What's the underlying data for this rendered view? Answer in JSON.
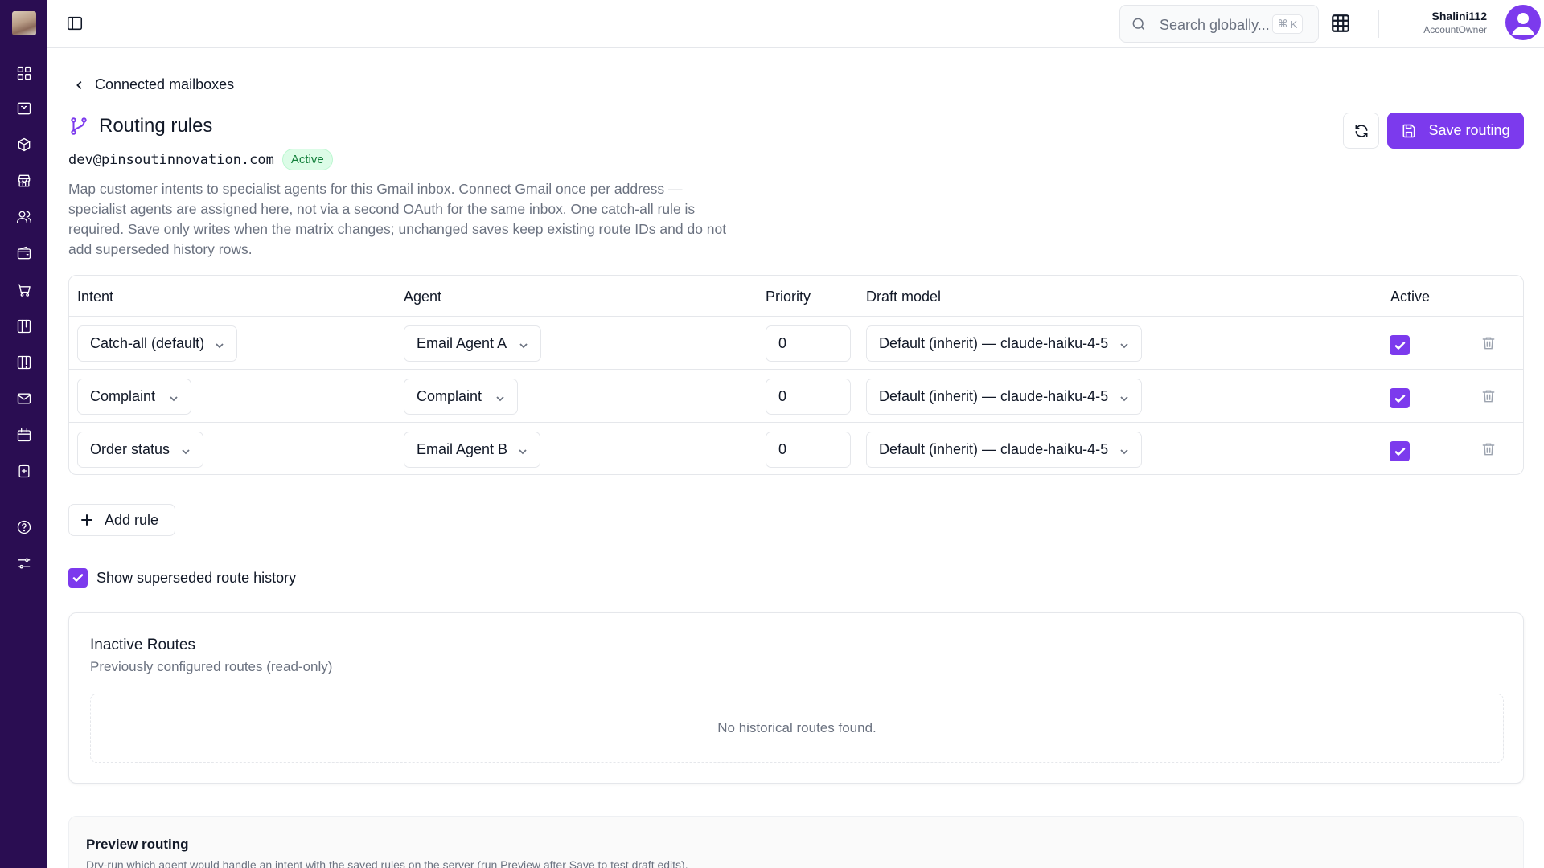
{
  "topbar": {
    "search_placeholder": "Search globally...",
    "search_shortcut_symbol": "⌘",
    "search_shortcut_key": "K",
    "user_name": "Shalini112",
    "user_role": "AccountOwner"
  },
  "sidebar": {
    "items": [
      {
        "icon": "dashboard-grid-icon"
      },
      {
        "icon": "inbox-icon"
      },
      {
        "icon": "package-icon"
      },
      {
        "icon": "store-icon"
      },
      {
        "icon": "users-icon"
      },
      {
        "icon": "wallet-icon"
      },
      {
        "icon": "shopping-cart-icon"
      },
      {
        "icon": "board-icon"
      },
      {
        "icon": "board-alt-icon"
      },
      {
        "icon": "mail-icon"
      },
      {
        "icon": "calendar-icon"
      },
      {
        "icon": "clipboard-icon"
      }
    ],
    "bottom_items": [
      {
        "icon": "help-icon"
      },
      {
        "icon": "settings-sliders-icon"
      }
    ]
  },
  "page": {
    "back_label": "Connected mailboxes",
    "title": "Routing rules",
    "email": "dev@pinsoutinnovation.com",
    "status_badge": "Active",
    "description": "Map customer intents to specialist agents for this Gmail inbox. Connect Gmail once per address — specialist agents are assigned here, not via a second OAuth for the same inbox. One catch-all rule is required. Save only writes when the matrix changes; unchanged saves keep existing route IDs and do not add superseded history rows.",
    "save_label": "Save routing"
  },
  "table": {
    "headers": {
      "intent": "Intent",
      "agent": "Agent",
      "priority": "Priority",
      "draft_model": "Draft model",
      "active": "Active"
    },
    "rows": [
      {
        "intent": "Catch-all (default)",
        "agent": "Email Agent A",
        "priority": "0",
        "draft_model": "Default (inherit) — claude-haiku-4-5",
        "active": true
      },
      {
        "intent": "Complaint",
        "agent": "Complaint",
        "priority": "0",
        "draft_model": "Default (inherit) — claude-haiku-4-5",
        "active": true
      },
      {
        "intent": "Order status",
        "agent": "Email Agent B",
        "priority": "0",
        "draft_model": "Default (inherit) — claude-haiku-4-5",
        "active": true
      }
    ]
  },
  "add_rule_label": "Add rule",
  "history_toggle": {
    "label": "Show superseded route history",
    "checked": true
  },
  "inactive_routes": {
    "title": "Inactive Routes",
    "subtitle": "Previously configured routes (read-only)",
    "empty_text": "No historical routes found."
  },
  "preview": {
    "title": "Preview routing",
    "subtitle": "Dry-run which agent would handle an intent with the saved rules on the server (run Preview after Save to test draft edits)."
  },
  "colors": {
    "sidebar_bg": "#2a0d52",
    "accent": "#7c3aed",
    "badge_bg": "#dcfce7",
    "badge_text": "#15803d"
  }
}
